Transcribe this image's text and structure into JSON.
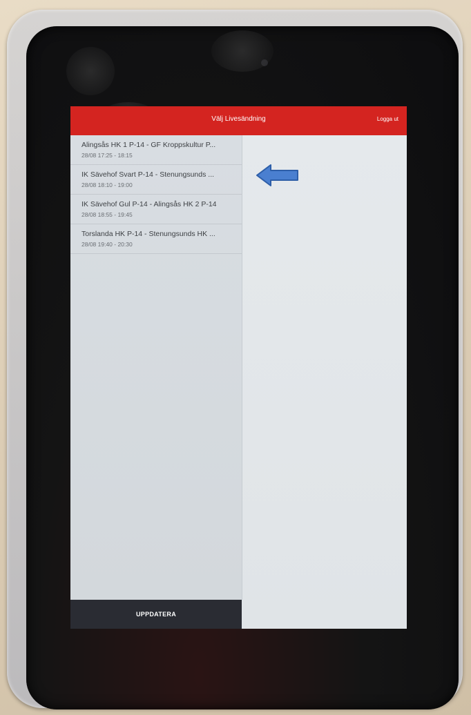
{
  "header": {
    "title": "Välj Livesändning",
    "logout_label": "Logga ut"
  },
  "broadcasts": [
    {
      "title": "Alingsås HK 1 P-14 - GF Kroppskultur P...",
      "time": "28/08 17:25 - 18:15"
    },
    {
      "title": "IK Sävehof Svart P-14 - Stenungsunds ...",
      "time": "28/08 18:10 - 19:00"
    },
    {
      "title": "IK Sävehof Gul P-14 - Alingsås HK 2 P-14",
      "time": "28/08 18:55 - 19:45"
    },
    {
      "title": "Torslanda HK P-14 - Stenungsunds HK ...",
      "time": "28/08 19:40 - 20:30"
    }
  ],
  "footer": {
    "update_label": "UPPDATERA"
  },
  "colors": {
    "header_bg": "#d42420",
    "update_bg": "#2a2c33",
    "arrow_fill": "#4a7fd0"
  },
  "icons": {
    "annotation": "left-arrow-icon"
  }
}
